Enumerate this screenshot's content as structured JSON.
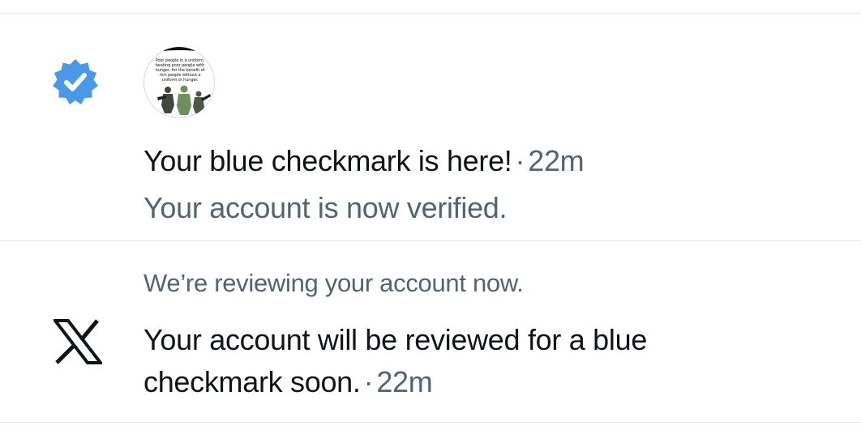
{
  "notifications": [
    {
      "icon": "verified-badge-icon",
      "avatar_text": "Poor people in a uniform, beating poor people with hunger, for the benefit of rich people without a uniform or hunger.",
      "title": "Your blue checkmark is here!",
      "separator": "·",
      "time": "22m",
      "subtitle": "Your account is now verified."
    },
    {
      "icon": "x-logo-icon",
      "heading": "We’re reviewing your account now.",
      "body_line1": "Your account will be reviewed for a blue",
      "body_line2": "checkmark soon.",
      "separator": "·",
      "time": "22m"
    }
  ],
  "colors": {
    "verified_blue": "#4a99e9",
    "primary_text": "#0f1419",
    "secondary_text": "#536471",
    "divider": "#e4e8eb"
  }
}
